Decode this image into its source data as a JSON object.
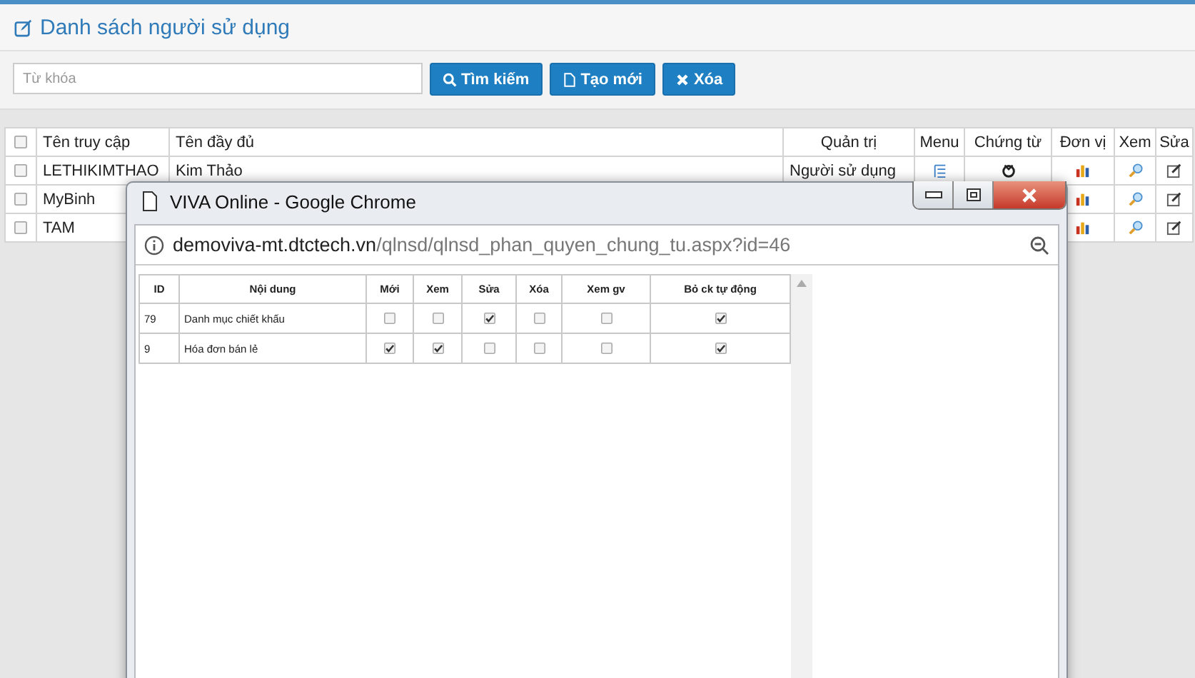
{
  "page": {
    "title": "Danh sách người sử dụng"
  },
  "search": {
    "placeholder": "Từ khóa",
    "buttons": [
      {
        "label": "Tìm kiếm",
        "kind": "search"
      },
      {
        "label": "Tạo mới",
        "kind": "new"
      },
      {
        "label": "Xóa",
        "kind": "delete"
      }
    ]
  },
  "users_table": {
    "header_checked": false,
    "columns": [
      "Tên truy cập",
      "Tên đầy đủ",
      "Quản trị",
      "Menu",
      "Chứng từ",
      "Đơn vị",
      "Xem",
      "Sửa"
    ],
    "rows": [
      {
        "checked": false,
        "username": "LETHIKIMTHAO",
        "full_name": "Kim Thảo",
        "role": "Người sử dụng"
      },
      {
        "checked": false,
        "username": "MyBinh"
      },
      {
        "checked": false,
        "username": "TAM"
      }
    ]
  },
  "popup": {
    "title": "VIVA Online - Google Chrome",
    "url_host": "demoviva-mt.dtctech.vn",
    "url_path": "/qlnsd/qlnsd_phan_quyen_chung_tu.aspx?id=46",
    "table": {
      "columns": [
        "ID",
        "Nội dung",
        "Mới",
        "Xem",
        "Sửa",
        "Xóa",
        "Xem gv",
        "Bỏ ck tự động"
      ],
      "rows": [
        {
          "id": "79",
          "content": "Danh mục chiết khấu",
          "permissions": [
            {
              "checked": false
            },
            {
              "checked": false
            },
            {
              "checked": true
            },
            {
              "checked": false
            },
            {
              "checked": false
            },
            {
              "checked": true
            }
          ]
        },
        {
          "id": "9",
          "content": "Hóa đơn bán lẻ",
          "permissions": [
            {
              "checked": true
            },
            {
              "checked": true
            },
            {
              "checked": false
            },
            {
              "checked": false
            },
            {
              "checked": false
            },
            {
              "checked": true
            }
          ]
        }
      ]
    }
  }
}
